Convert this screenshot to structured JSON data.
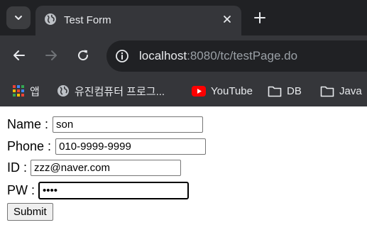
{
  "browser": {
    "tab": {
      "title": "Test Form"
    },
    "address": {
      "host": "localhost",
      "path": ":8080/tc/testPage.do"
    },
    "bookmarks": [
      {
        "label": "앱",
        "icon": "apps-grid-icon"
      },
      {
        "label": "유진컴퓨터 프로그...",
        "icon": "globe-icon"
      },
      {
        "label": "YouTube",
        "icon": "youtube-icon"
      },
      {
        "label": "DB",
        "icon": "folder-icon"
      },
      {
        "label": "Java",
        "icon": "folder-icon"
      }
    ],
    "colors": {
      "tabstrip": "#202124",
      "toolbar": "#35363a",
      "text": "#e8eaed",
      "youtube": "#ff0000"
    }
  },
  "form": {
    "name": {
      "label": "Name :",
      "value": "son"
    },
    "phone": {
      "label": "Phone :",
      "value": "010-9999-9999"
    },
    "id": {
      "label": "ID :",
      "value": "zzz@naver.com"
    },
    "pw": {
      "label": "PW :",
      "value": "••••"
    },
    "submit_label": "Submit"
  }
}
